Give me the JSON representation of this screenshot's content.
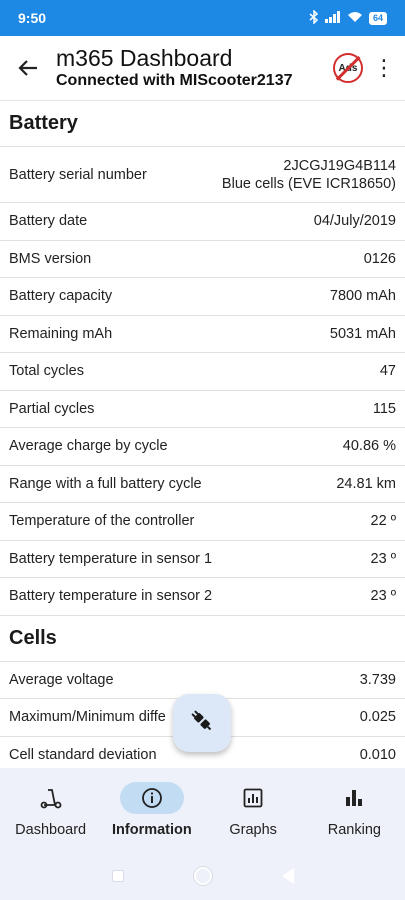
{
  "status_bar": {
    "time": "9:50",
    "battery_level": "64",
    "icons": [
      "bluetooth-icon",
      "signal-icon",
      "wifi-icon",
      "battery-icon"
    ]
  },
  "app_bar": {
    "title": "m365 Dashboard",
    "subtitle": "Connected with MIScooter2137",
    "noads_label": "Ads"
  },
  "battery": {
    "heading": "Battery",
    "serial_label": "Battery serial number",
    "serial_value": "2JCGJ19G4B114",
    "serial_cells": "Blue cells (EVE ICR18650)",
    "rows": [
      {
        "label": "Battery date",
        "value": "04/July/2019"
      },
      {
        "label": "BMS version",
        "value": "0126"
      },
      {
        "label": "Battery capacity",
        "value": "7800 mAh"
      },
      {
        "label": "Remaining mAh",
        "value": "5031 mAh"
      },
      {
        "label": "Total cycles",
        "value": "47"
      },
      {
        "label": "Partial cycles",
        "value": "115"
      },
      {
        "label": "Average charge by cycle",
        "value": "40.86 %"
      },
      {
        "label": "Range with a full battery cycle",
        "value": "24.81 km"
      },
      {
        "label": "Temperature of the controller",
        "value": "22 º"
      },
      {
        "label": "Battery temperature in sensor 1",
        "value": "23 º"
      },
      {
        "label": "Battery temperature in sensor 2",
        "value": "23 º"
      }
    ]
  },
  "cells": {
    "heading": "Cells",
    "rows": [
      {
        "label": "Average voltage",
        "value": "3.739"
      },
      {
        "label": "Maximum/Minimum diffe",
        "value": "0.025"
      },
      {
        "label": "Cell standard deviation",
        "value": "0.010"
      }
    ]
  },
  "bottom_nav": [
    {
      "label": "Dashboard",
      "icon": "scooter-icon",
      "active": false
    },
    {
      "label": "Information",
      "icon": "info-icon",
      "active": true
    },
    {
      "label": "Graphs",
      "icon": "chart-icon",
      "active": false
    },
    {
      "label": "Ranking",
      "icon": "bar-chart-icon",
      "active": false
    }
  ],
  "colors": {
    "status_bar": "#1e88e5",
    "nav_bg": "#eef1f9",
    "nav_active": "#c2dcf4",
    "fab_bg": "#dce8f7"
  }
}
